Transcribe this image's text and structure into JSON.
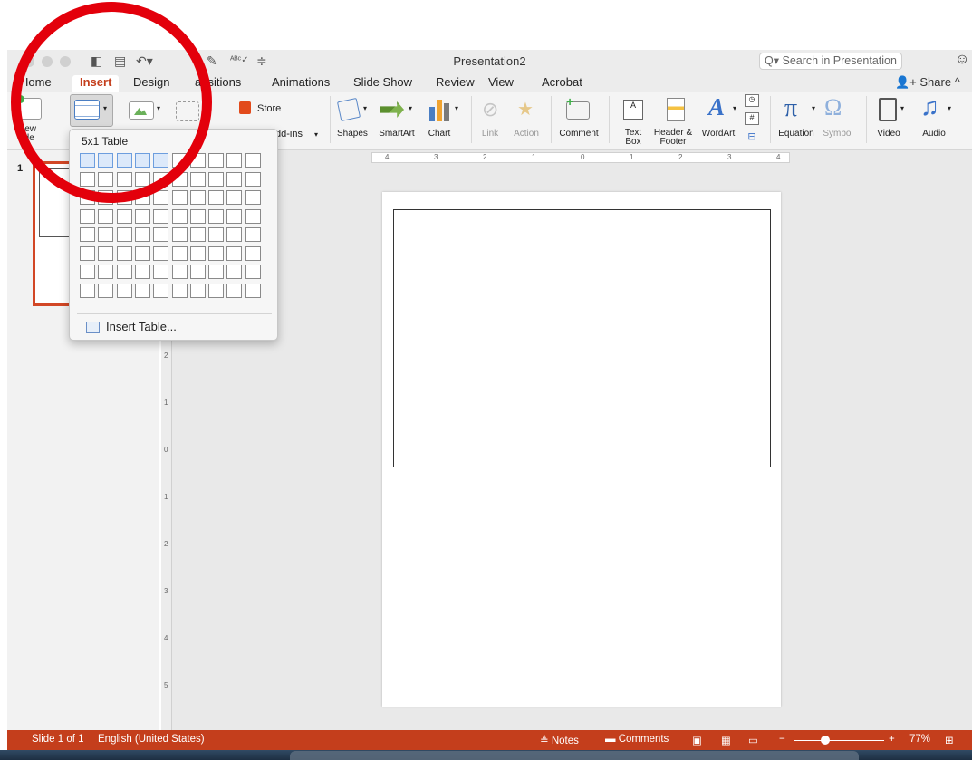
{
  "window": {
    "title": "Presentation2"
  },
  "search": {
    "placeholder": "Search in Presentation"
  },
  "tabs": [
    {
      "label": "Home"
    },
    {
      "label": "Insert"
    },
    {
      "label": "Design"
    },
    {
      "label": "ansitions"
    },
    {
      "label": "Animations"
    },
    {
      "label": "Slide Show"
    },
    {
      "label": "Review"
    },
    {
      "label": "View"
    },
    {
      "label": "Acrobat"
    }
  ],
  "share_label": "Share",
  "ribbon": {
    "new_slide": "New\nlide",
    "store": "Store",
    "addins": "dd-ins",
    "shapes": "Shapes",
    "smartart": "SmartArt",
    "chart": "Chart",
    "link": "Link",
    "action": "Action",
    "comment": "Comment",
    "textbox": "Text\nBox",
    "header_footer": "Header &\nFooter",
    "wordart": "WordArt",
    "equation": "Equation",
    "symbol": "Symbol",
    "video": "Video",
    "audio": "Audio"
  },
  "table_dropdown": {
    "size_label": "5x1 Table",
    "cols": 10,
    "rows": 8,
    "selected_cols": 5,
    "selected_rows": 1,
    "insert_table": "Insert Table..."
  },
  "thumbnail": {
    "number": "1"
  },
  "ruler_ticks": [
    "4",
    "3",
    "2",
    "1",
    "0",
    "1",
    "2",
    "3",
    "4"
  ],
  "vruler_ticks": [
    "2",
    "1",
    "0",
    "1",
    "2",
    "3",
    "4",
    "5"
  ],
  "status": {
    "slide": "Slide 1 of 1",
    "language": "English (United States)",
    "notes": "Notes",
    "comments": "Comments",
    "zoom": "77%"
  },
  "colors": {
    "accent": "#c43e1c",
    "annotation": "#e3000b"
  }
}
